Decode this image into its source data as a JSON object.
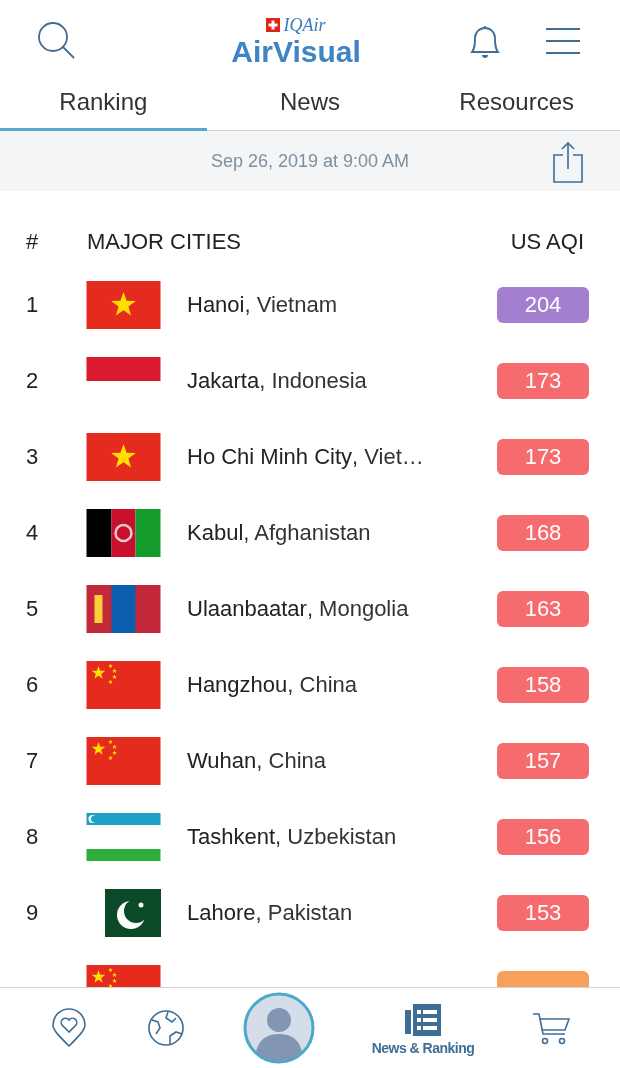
{
  "header": {
    "brand_small": "IQAir",
    "brand": "AirVisual"
  },
  "tabs": [
    {
      "label": "Ranking",
      "selected": true
    },
    {
      "label": "News",
      "selected": false
    },
    {
      "label": "Resources",
      "selected": false
    }
  ],
  "date": "Sep 26, 2019 at 9:00 AM",
  "table": {
    "columns": [
      "#",
      "MAJOR CITIES",
      "US AQI"
    ],
    "rows": [
      {
        "rank": "1",
        "kind": "vietnam",
        "city": "Hanoi",
        "country": ", Vietnam",
        "aqi": "204",
        "color": "#a47fd0"
      },
      {
        "rank": "2",
        "kind": "indonesia",
        "city": "Jakarta",
        "country": ", Indonesia",
        "aqi": "173",
        "color": "#f66b6d"
      },
      {
        "rank": "3",
        "kind": "vietnam",
        "city": "Ho Chi Minh City",
        "country": ", Viet…",
        "aqi": "173",
        "color": "#f66b6d"
      },
      {
        "rank": "4",
        "kind": "afghanistan",
        "city": "Kabul",
        "country": ", Afghanistan",
        "aqi": "168",
        "color": "#f66b6d"
      },
      {
        "rank": "5",
        "kind": "mongolia",
        "city": "Ulaanbaatar",
        "country": ", Mongolia",
        "aqi": "163",
        "color": "#f66b6d"
      },
      {
        "rank": "6",
        "kind": "china",
        "city": "Hangzhou",
        "country": ", China",
        "aqi": "158",
        "color": "#f66b6d"
      },
      {
        "rank": "7",
        "kind": "china",
        "city": "Wuhan",
        "country": ", China",
        "aqi": "157",
        "color": "#f66b6d"
      },
      {
        "rank": "8",
        "kind": "uzbekistan",
        "city": "Tashkent",
        "country": ", Uzbekistan",
        "aqi": "156",
        "color": "#f66b6d"
      },
      {
        "rank": "9",
        "kind": "pakistan",
        "city": "Lahore",
        "country": ", Pakistan",
        "aqi": "153",
        "color": "#f66b6d"
      },
      {
        "kind": "china",
        "color": "#f6a05c"
      }
    ]
  },
  "nav": [
    {
      "kind": "favorites"
    },
    {
      "kind": "map"
    },
    {
      "kind": "profile"
    },
    {
      "kind": "news",
      "label": "News & Ranking"
    },
    {
      "kind": "cart"
    }
  ]
}
